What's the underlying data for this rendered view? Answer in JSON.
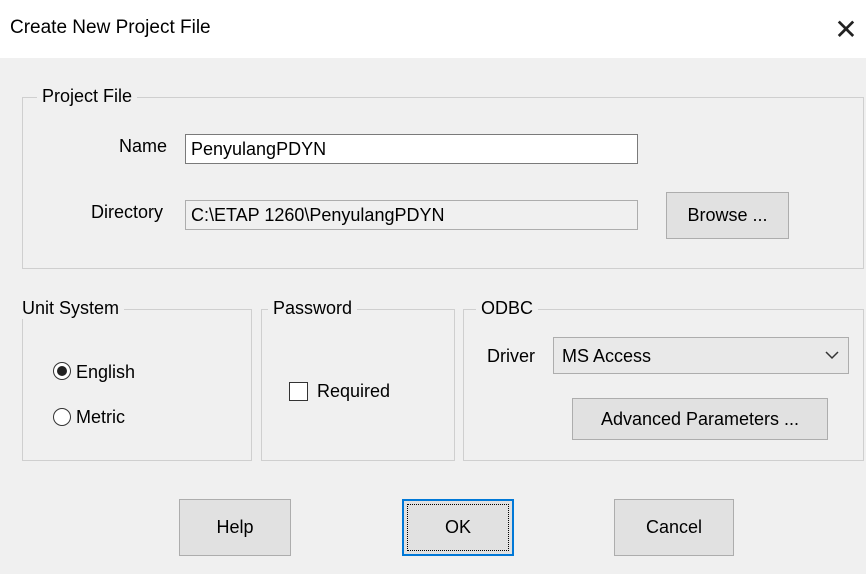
{
  "dialog": {
    "title": "Create New Project File",
    "close_symbol": "✕"
  },
  "project_file": {
    "legend": "Project File",
    "name_label": "Name",
    "name_value": "PenyulangPDYN",
    "directory_label": "Directory",
    "directory_value": "C:\\ETAP 1260\\PenyulangPDYN",
    "browse_label": "Browse ..."
  },
  "unit_system": {
    "legend": "Unit System",
    "options": [
      {
        "label": "English",
        "checked": true
      },
      {
        "label": "Metric",
        "checked": false
      }
    ]
  },
  "password": {
    "legend": "Password",
    "required_label": "Required",
    "required_checked": false
  },
  "odbc": {
    "legend": "ODBC",
    "driver_label": "Driver",
    "driver_value": "MS Access",
    "advanced_label": "Advanced Parameters ..."
  },
  "footer": {
    "help_label": "Help",
    "ok_label": "OK",
    "cancel_label": "Cancel"
  },
  "icons": {
    "close": "close-icon",
    "dropdown": "chevron-down-icon"
  }
}
